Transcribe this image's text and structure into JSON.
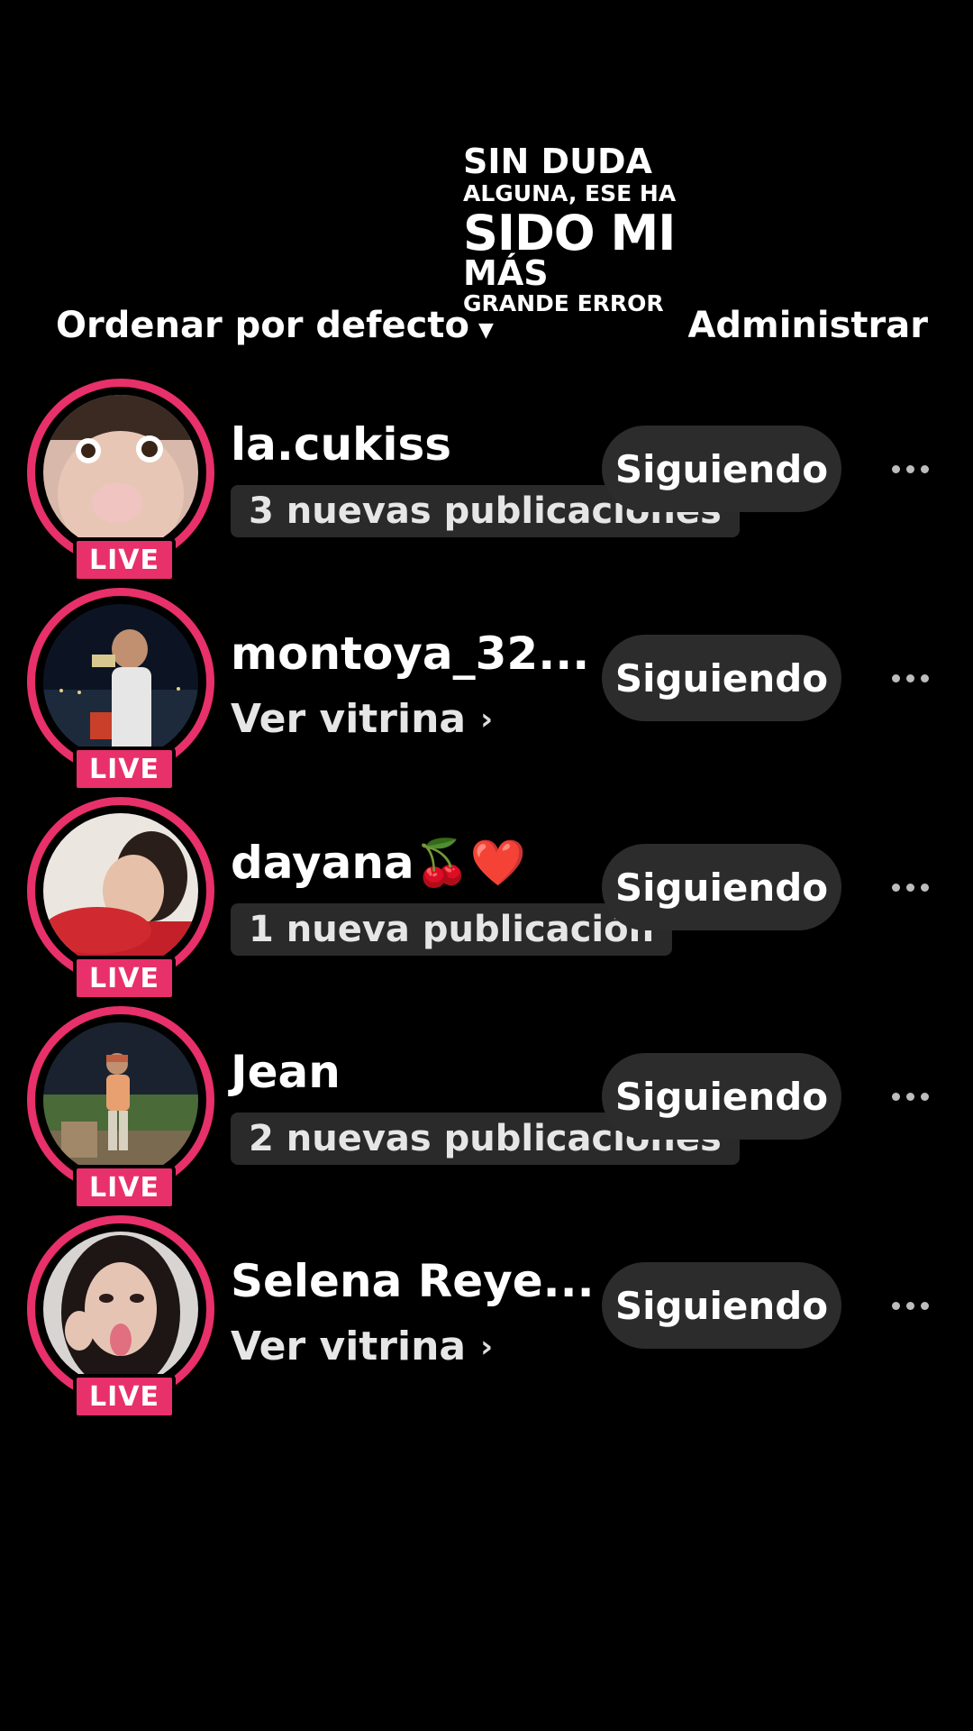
{
  "overlay": {
    "line1": "SIN DUDA",
    "line2": "ALGUNA, ESE HA",
    "line3": "SIDO MI",
    "line4": "MÁS",
    "line5": "GRANDE ERROR"
  },
  "topbar": {
    "sort_label": "Ordenar por defecto",
    "manage_label": "Administrar"
  },
  "accounts": [
    {
      "name": "la.cukiss",
      "sub": "3 nuevas publicaciones",
      "sub_type": "pill",
      "live_label": "LIVE",
      "follow_label": "Siguiendo"
    },
    {
      "name": "montoya_32...",
      "sub": "Ver vitrina",
      "sub_type": "link",
      "live_label": "LIVE",
      "follow_label": "Siguiendo"
    },
    {
      "name": "dayana🍒❤️",
      "sub": "1 nueva publicación",
      "sub_type": "pill",
      "live_label": "LIVE",
      "follow_label": "Siguiendo"
    },
    {
      "name": "Jean",
      "sub": "2 nuevas publicaciones",
      "sub_type": "pill",
      "live_label": "LIVE",
      "follow_label": "Siguiendo"
    },
    {
      "name": "Selena Reye...",
      "sub": "Ver vitrina",
      "sub_type": "link",
      "live_label": "LIVE",
      "follow_label": "Siguiendo"
    }
  ],
  "colors": {
    "background": "#000000",
    "live_ring": "#e8306a",
    "button_bg": "#2c2c2c",
    "pill_bg": "#2a2a2a"
  }
}
